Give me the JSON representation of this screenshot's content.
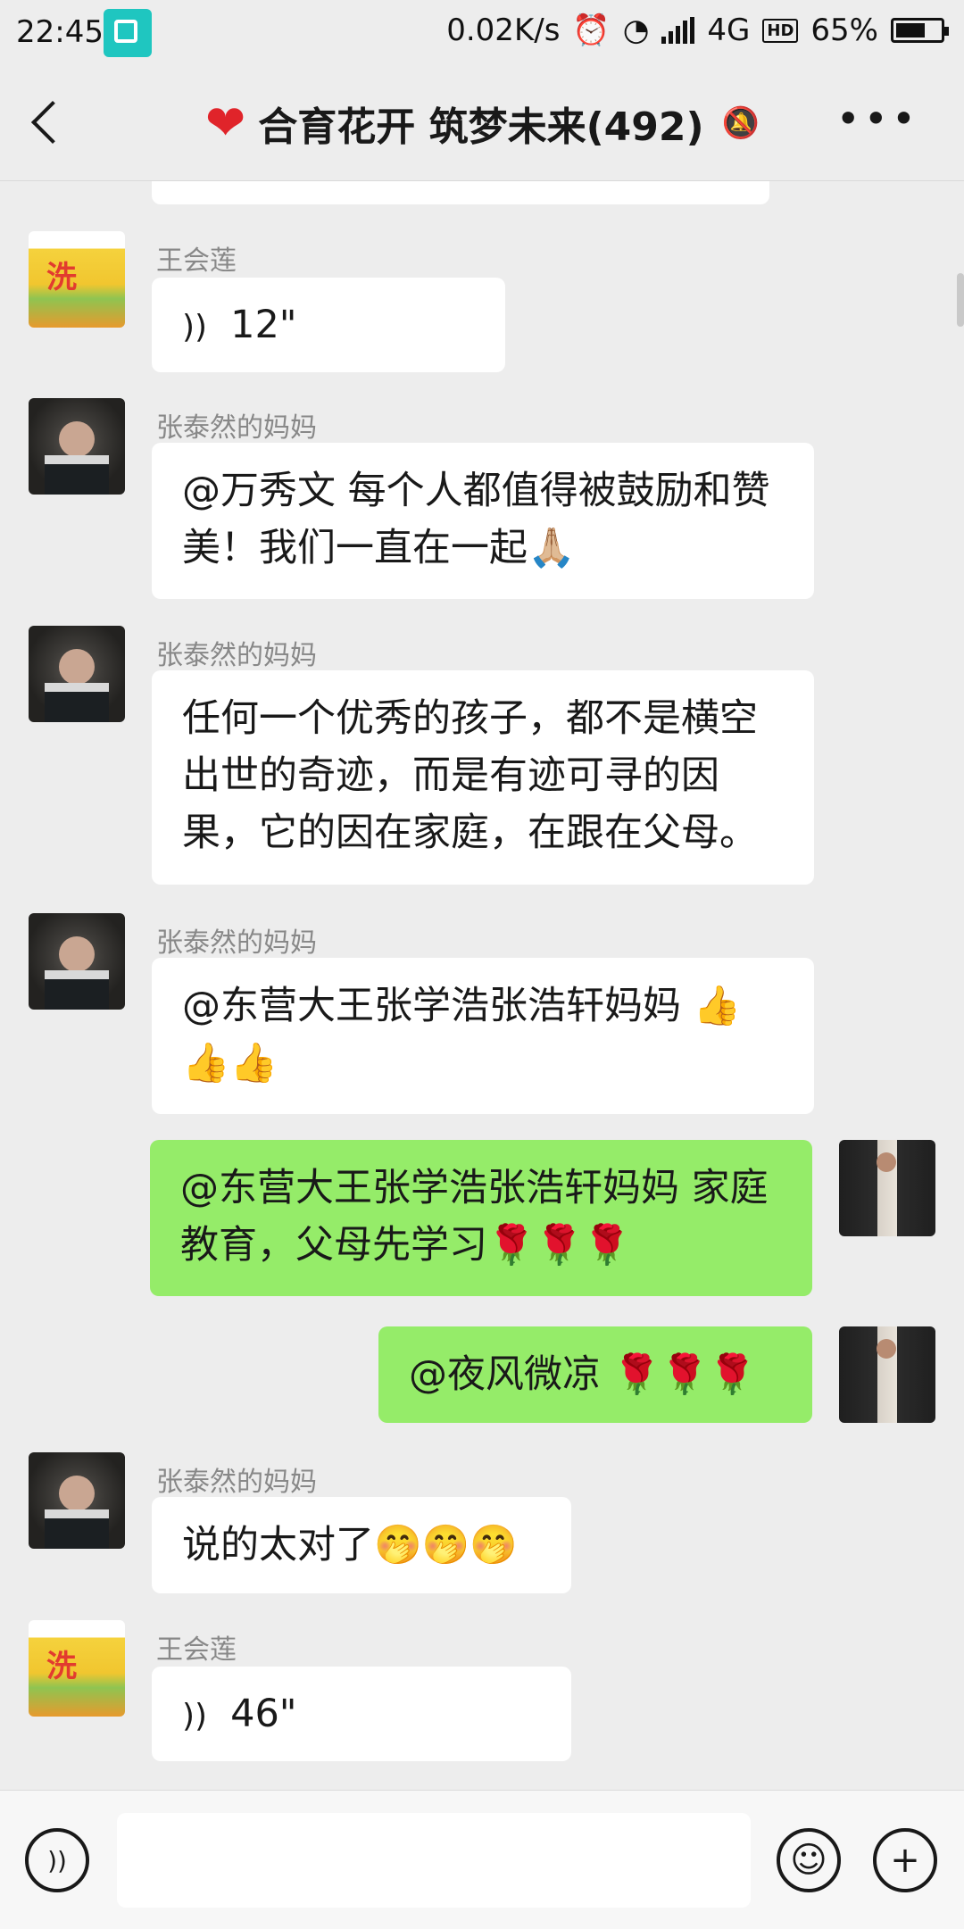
{
  "status_bar": {
    "time": "22:45",
    "speed": "0.02K/s",
    "network": "4G",
    "hd": "HD",
    "battery": "65%"
  },
  "header": {
    "title": "合育花开 筑梦未来(492)",
    "heart_icon": "heart-icon",
    "mute_icon": "muted-bell-icon"
  },
  "messages": [
    {
      "sender": "王会莲",
      "voice": "12\""
    },
    {
      "sender": "张泰然的妈妈",
      "text": "@万秀文  每个人都值得被鼓励和赞美！我们一直在一起🙏🏼"
    },
    {
      "sender": "张泰然的妈妈",
      "text": "任何一个优秀的孩子，都不是横空出世的奇迹，而是有迹可寻的因果，它的因在家庭，在跟在父母。"
    },
    {
      "sender": "张泰然的妈妈",
      "text": "@东营大王张学浩张浩轩妈妈 👍👍👍"
    },
    {
      "sender": "",
      "text": "@东营大王张学浩张浩轩妈妈  家庭教育，父母先学习🌹🌹🌹"
    },
    {
      "sender": "",
      "text": "@夜风微凉 🌹🌹🌹"
    },
    {
      "sender": "张泰然的妈妈",
      "text": "说的太对了🤭🤭🤭"
    },
    {
      "sender": "王会莲",
      "voice": "46\""
    }
  ],
  "bottom_bar": {
    "voice_icon": "voice-mode-icon",
    "emoji_icon": "emoji-icon",
    "plus_icon": "plus-icon",
    "input_value": ""
  }
}
